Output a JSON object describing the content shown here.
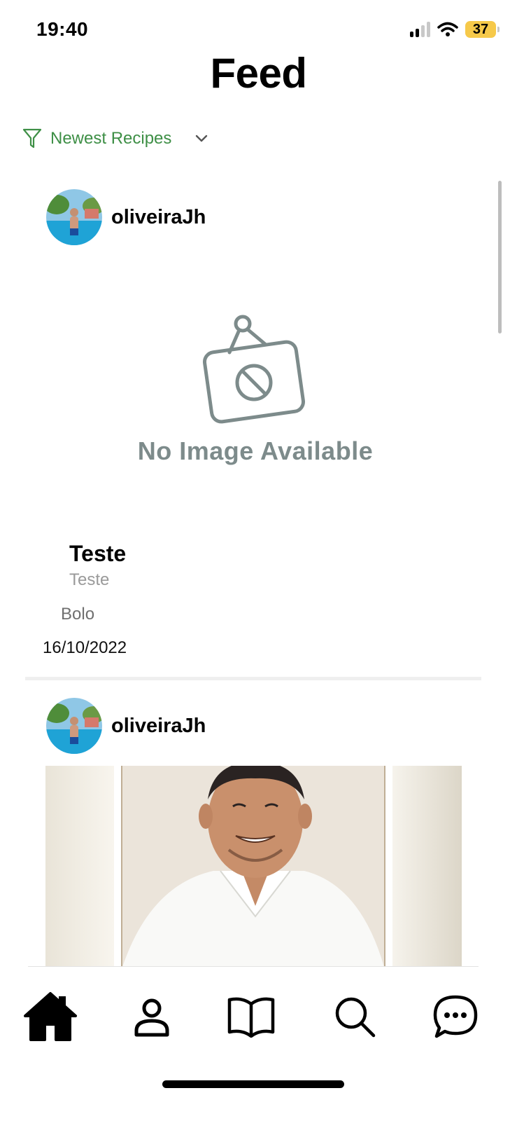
{
  "status_bar": {
    "time": "19:40",
    "battery_level": "37",
    "battery_color": "#f6c94a"
  },
  "header": {
    "title": "Feed"
  },
  "filter": {
    "label": "Newest Recipes",
    "accent_color": "#3e8f46",
    "icon": "filter-icon",
    "dropdown_icon": "chevron-down-icon"
  },
  "feed": {
    "posts": [
      {
        "username": "oliveiraJh",
        "image_placeholder": "No Image Available",
        "title": "Teste",
        "subtitle": "Teste",
        "category": "Bolo",
        "date": "16/10/2022"
      },
      {
        "username": "oliveiraJh"
      }
    ]
  },
  "tabbar": {
    "items": [
      {
        "icon": "home-icon",
        "active": true
      },
      {
        "icon": "profile-icon",
        "active": false
      },
      {
        "icon": "book-icon",
        "active": false
      },
      {
        "icon": "search-icon",
        "active": false
      },
      {
        "icon": "chat-icon",
        "active": false
      }
    ]
  }
}
